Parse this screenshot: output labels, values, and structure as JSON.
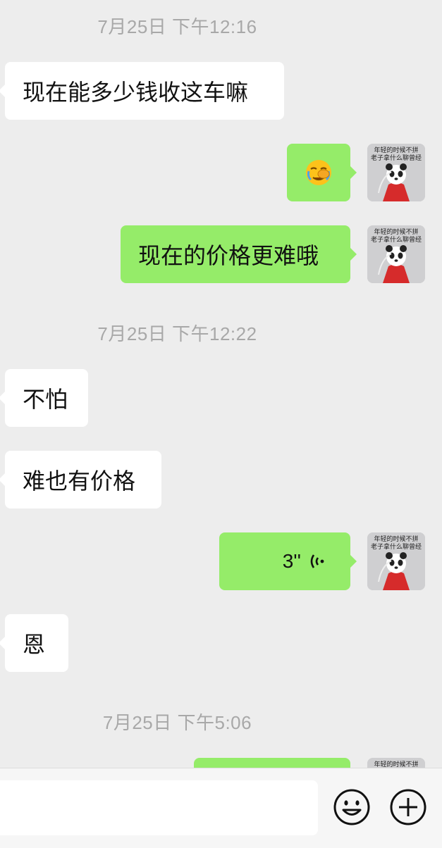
{
  "messages": [
    {
      "type": "time",
      "text": "7月25日 下午12:16"
    },
    {
      "type": "in",
      "text": "现在能多少钱收这车嘛"
    },
    {
      "type": "out-emoji",
      "emoji": "face-with-hand-crying-emoji"
    },
    {
      "type": "out",
      "text": "现在的价格更难哦"
    },
    {
      "type": "time",
      "text": "7月25日 下午12:22"
    },
    {
      "type": "in",
      "text": "不怕"
    },
    {
      "type": "in",
      "text": "难也有价格"
    },
    {
      "type": "out-voice",
      "duration": "3''"
    },
    {
      "type": "in",
      "text": "恩"
    },
    {
      "type": "time",
      "text": "7月25日 下午5:06"
    }
  ],
  "avatar": {
    "caption_line1": "年轻的时候不拼",
    "caption_line2": "老子拿什么聊曾经",
    "description_icon": "panda-avatar"
  },
  "input_bar": {
    "emoji_icon": "smiley-icon",
    "plus_icon": "plus-icon"
  },
  "colors": {
    "background": "#ededed",
    "incoming_bubble": "#ffffff",
    "outgoing_bubble": "#95ec69",
    "timestamp": "#a8a8a8"
  }
}
